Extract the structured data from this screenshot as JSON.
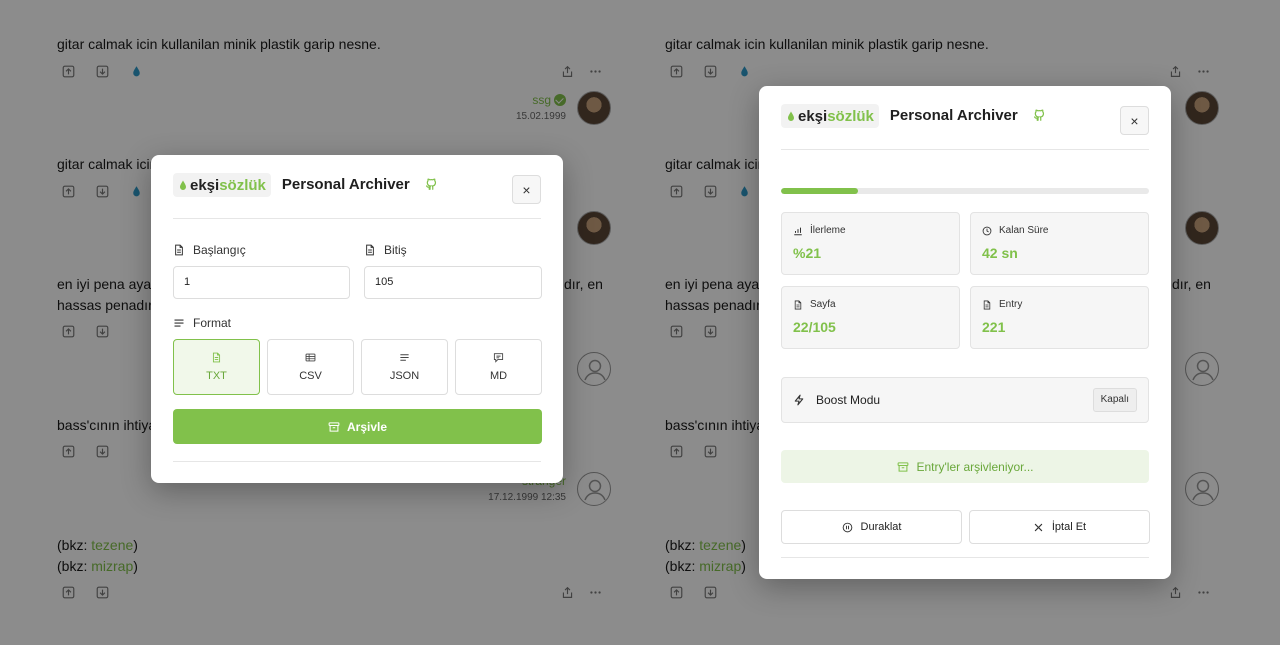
{
  "feed": {
    "entries": [
      {
        "text": "gitar calmak icin kullanilan minik plastik garip nesne."
      },
      {
        "text": "gitar calmak icin kullanilan minik plastik garip nesne."
      },
      {
        "line1": "en iyi pena ayak",
        "line1_tail": "dır, en",
        "line2": "hassas penadır."
      },
      {
        "text": "bass'cının ihtiyac"
      },
      {
        "bkz1_prefix": "(bkz: ",
        "bkz1_link": "tezene",
        "bkz1_suffix": ")",
        "bkz2_prefix": "(bkz: ",
        "bkz2_link": "mizrap",
        "bkz2_suffix": ")"
      }
    ],
    "authors": [
      {
        "nick": "ssg",
        "date": "15.02.1999"
      },
      {
        "nick": "stranger",
        "date": "17.12.1999 12:35"
      }
    ]
  },
  "archiver_form": {
    "logo_eksi": "ekşi",
    "logo_sozluk": "sözlük",
    "title": "Personal Archiver",
    "close_label": "×",
    "start_label": "Başlangıç",
    "start_value": "1",
    "end_label": "Bitiş",
    "end_value": "105",
    "format_label": "Format",
    "formats": [
      "TXT",
      "CSV",
      "JSON",
      "MD"
    ],
    "selected_format": "TXT",
    "archive_button": "Arşivle"
  },
  "archiver_progress": {
    "logo_eksi": "ekşi",
    "logo_sozluk": "sözlük",
    "title": "Personal Archiver",
    "close_label": "×",
    "progress_fraction": 0.21,
    "stats": {
      "progress_label": "İlerleme",
      "progress_value": "%21",
      "time_label": "Kalan Süre",
      "time_value": "42 sn",
      "page_label": "Sayfa",
      "page_value": "22/105",
      "entry_label": "Entry",
      "entry_value": "221"
    },
    "boost_label": "Boost Modu",
    "boost_state": "Kapalı",
    "archiving_status": "Entry'ler arşivleniyor...",
    "pause_button": "Duraklat",
    "cancel_button": "İptal Et"
  },
  "colors": {
    "brand_green": "#81c14b",
    "overlay": "rgba(0,0,0,0.45)"
  },
  "icons": [
    "upvote-icon",
    "downvote-icon",
    "drop-icon",
    "share-icon",
    "more-icon",
    "github-icon",
    "file-icon",
    "lines-icon",
    "table-icon",
    "message-icon",
    "archive-icon",
    "chart-icon",
    "clock-icon",
    "bolt-icon",
    "pause-icon",
    "x-icon"
  ]
}
